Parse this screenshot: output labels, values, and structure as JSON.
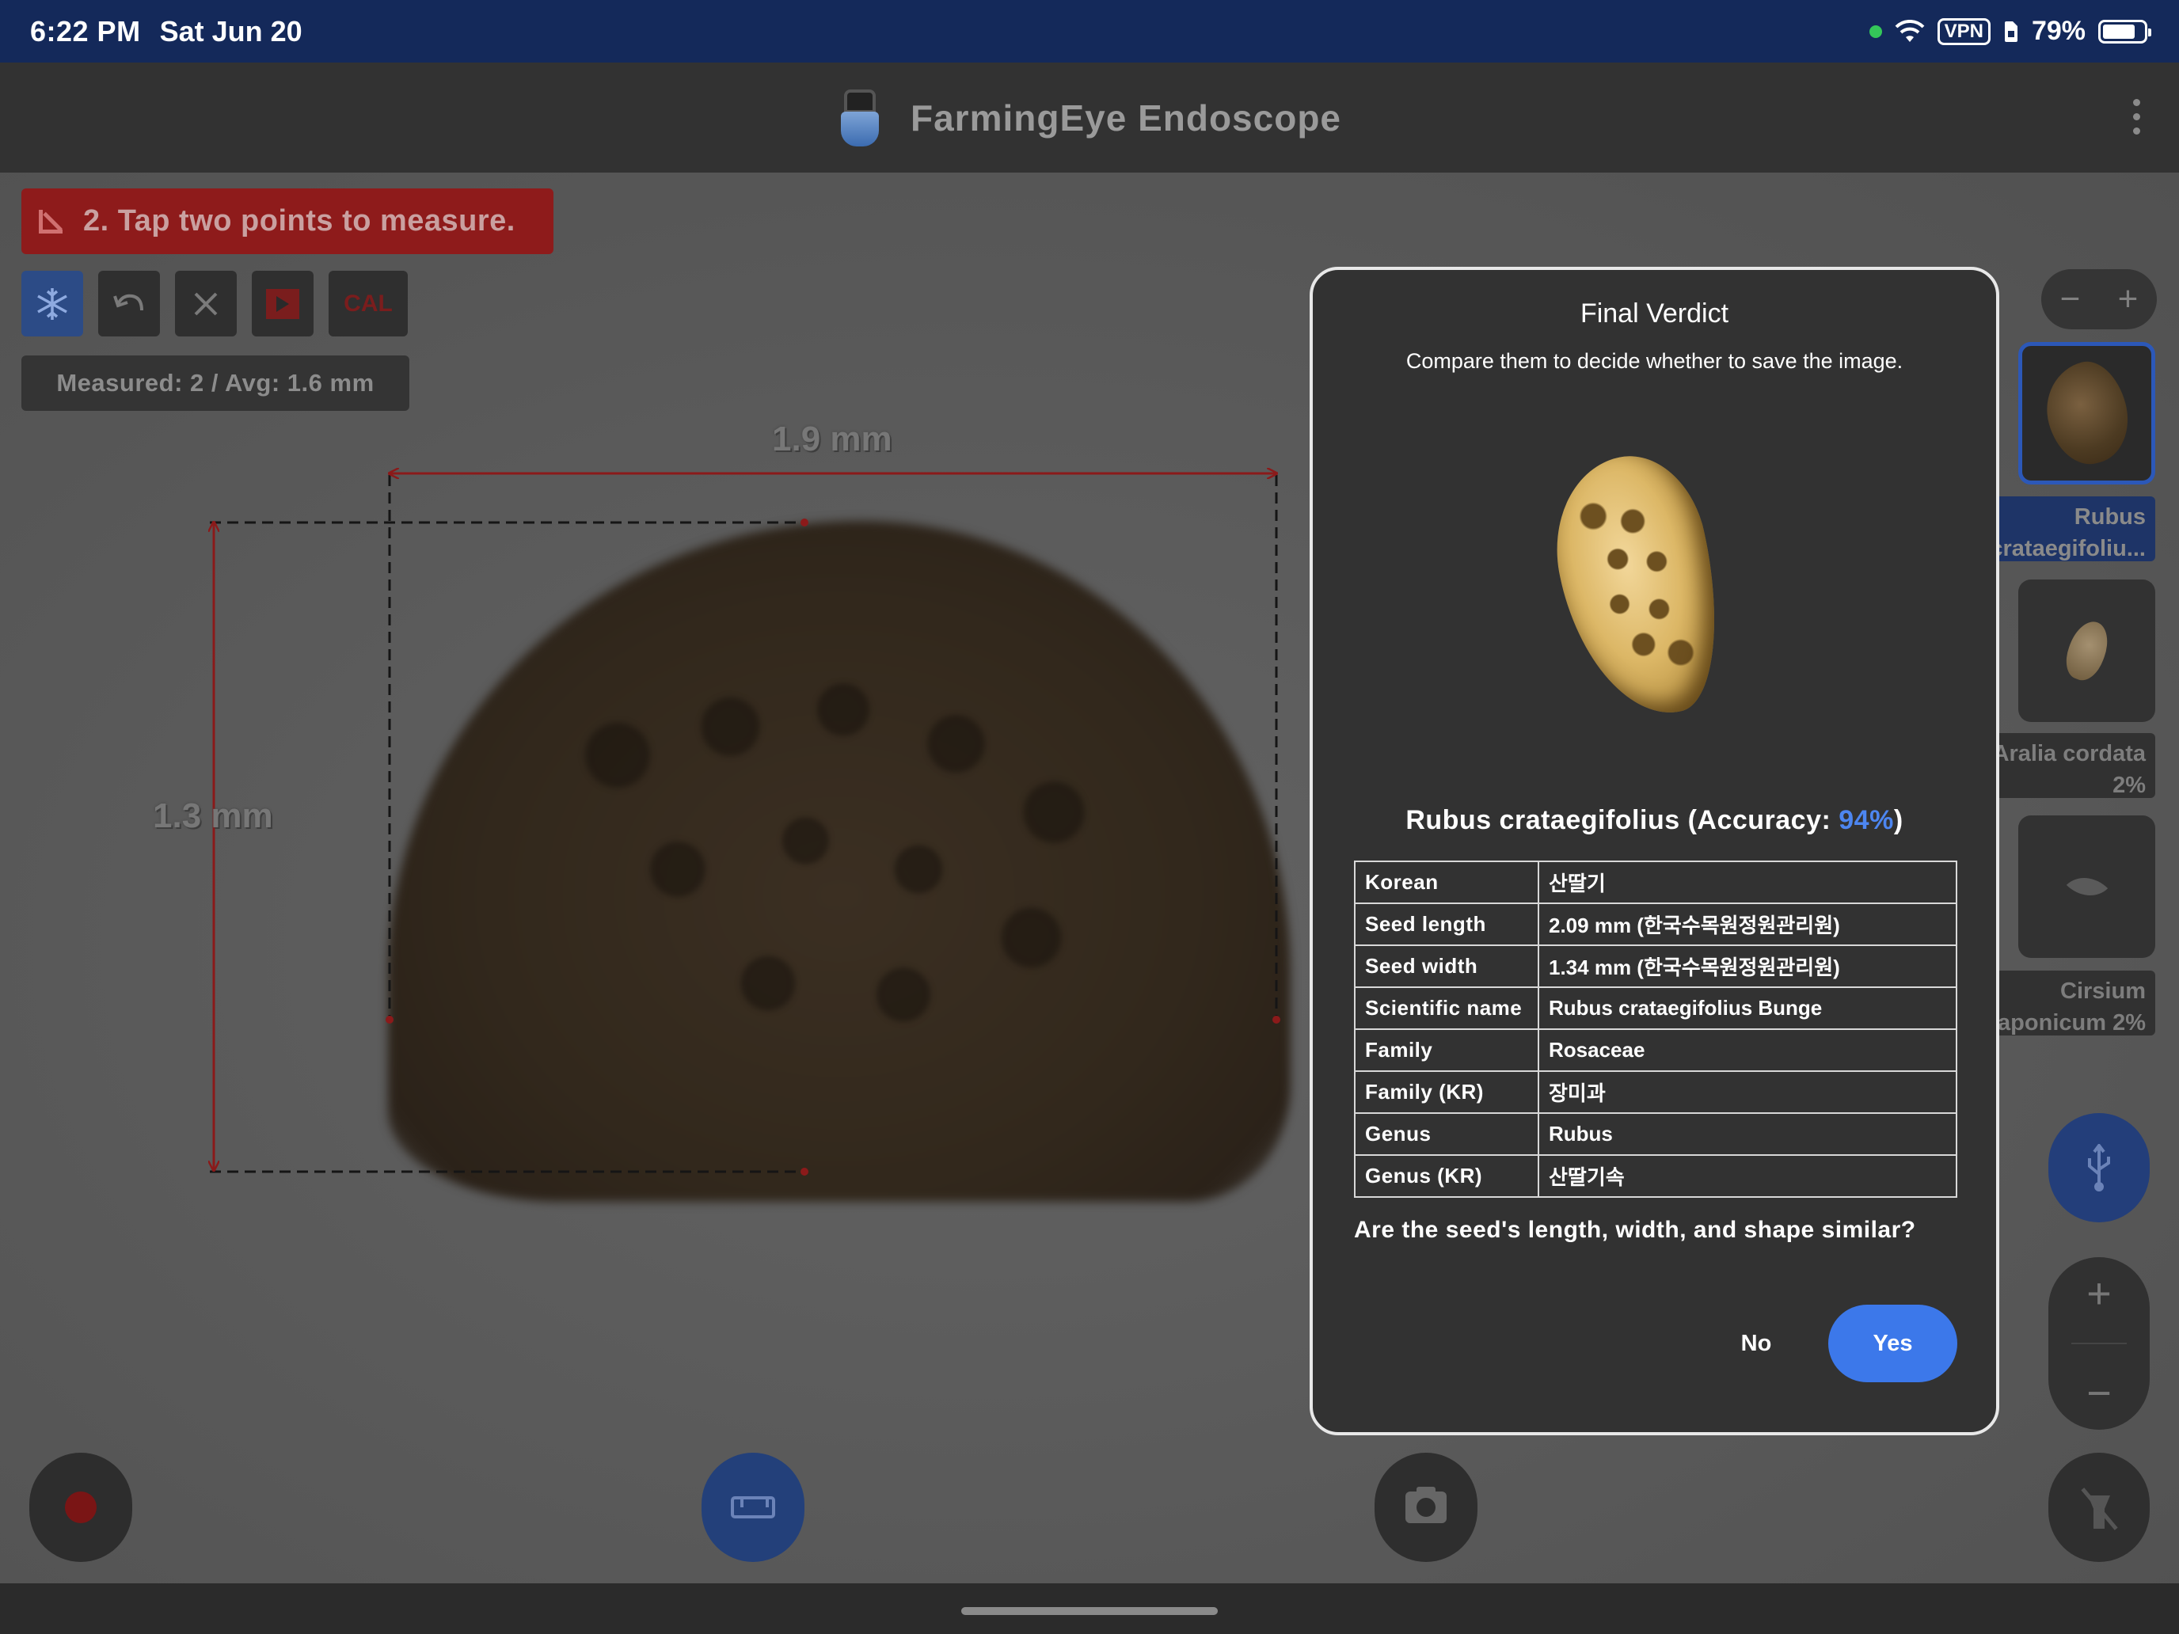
{
  "status_bar": {
    "time": "6:22 PM",
    "date": "Sat Jun 20",
    "vpn": "VPN",
    "battery": "79%",
    "battery_level": 0.79
  },
  "app_bar": {
    "title": "FarmingEye Endoscope",
    "logo_icon": "endoscope-icon",
    "menu_icon": "kebab-menu-icon"
  },
  "toolbar": {
    "instruction": "2. Tap two points to measure.",
    "freeze_icon": "snowflake-icon",
    "undo_icon": "undo-icon",
    "clear_icon": "close-icon",
    "play_icon": "play-icon",
    "cal_label": "CAL",
    "measured_summary": "Measured: 2  /  Avg: 1.6 mm"
  },
  "measurements": {
    "width_label": "1.9 mm",
    "height_label": "1.3 mm",
    "line_color": "#8b1a1a"
  },
  "side_panel": {
    "zoom_minus": "−",
    "zoom_plus": "+",
    "candidates": [
      {
        "label": "Rubus crataegifoliu...",
        "selected": true
      },
      {
        "label": "Aralia cordata 2%",
        "selected": false
      },
      {
        "label": "Cirsium japonicum 2%",
        "selected": false
      }
    ],
    "usb_icon": "usb-icon",
    "vertical_zoom_plus": "+",
    "vertical_zoom_minus": "−",
    "flash_icon": "flash-off-icon"
  },
  "bottom_bar": {
    "record_icon": "record-icon",
    "measure_icon": "ruler-icon",
    "camera_icon": "camera-icon"
  },
  "dialog": {
    "title": "Final Verdict",
    "subtitle": "Compare them to decide whether to save the image.",
    "verdict_prefix": "Rubus crataegifolius (Accuracy: ",
    "accuracy": "94%",
    "verdict_suffix": ")",
    "rows": [
      {
        "key": "Korean",
        "value": "산딸기"
      },
      {
        "key": "Seed length",
        "value": "2.09 mm (한국수목원정원관리원)"
      },
      {
        "key": "Seed width",
        "value": "1.34 mm (한국수목원정원관리원)"
      },
      {
        "key": "Scientific name",
        "value": "Rubus crataegifolius Bunge"
      },
      {
        "key": "Family",
        "value": "Rosaceae"
      },
      {
        "key": "Family (KR)",
        "value": "장미과"
      },
      {
        "key": "Genus",
        "value": "Rubus"
      },
      {
        "key": "Genus (KR)",
        "value": "산딸기속"
      }
    ],
    "question": "Are the seed's length, width, and shape similar?",
    "no_label": "No",
    "yes_label": "Yes",
    "accent_color": "#3c78ea"
  }
}
